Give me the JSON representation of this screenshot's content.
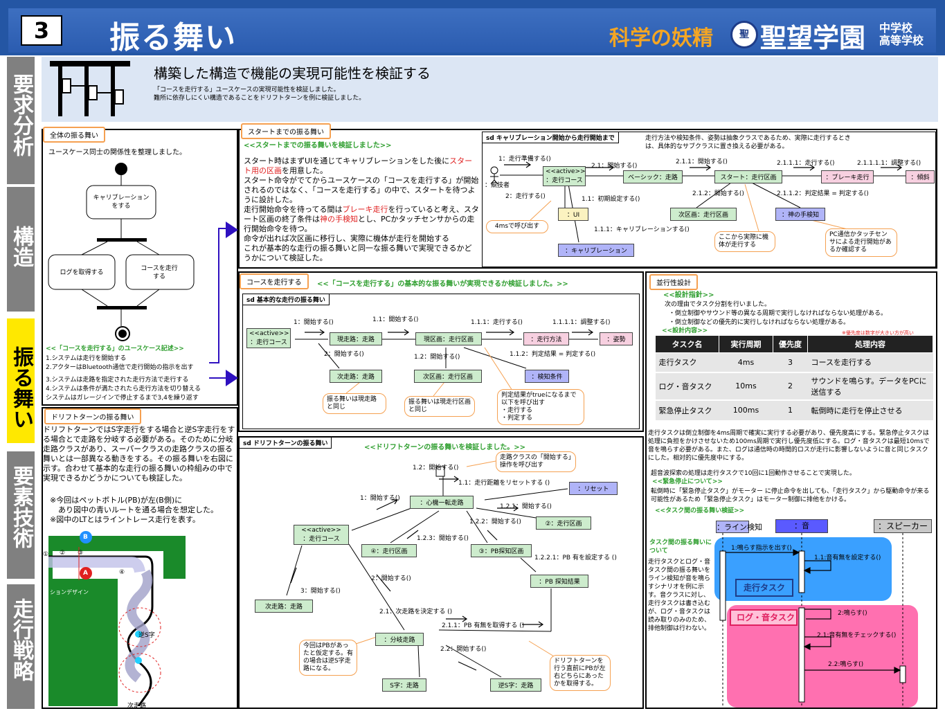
{
  "header": {
    "num": "3",
    "title": "振る舞い",
    "brand1": "科学の妖精",
    "logo": "聖",
    "brand2": "聖望学園",
    "brand3a": "中学校",
    "brand3b": "高等学校"
  },
  "sidebar": [
    "要求分析",
    "構造",
    "振る舞い",
    "要素技術",
    "走行戦略"
  ],
  "intro": {
    "title": "構築した構造で機能の実現可能性を検証する",
    "line1": "「コースを走行する」ユースケースの実現可能性を検証しました。",
    "line2": "難所に依存しにくい構造であることをドリフトターンを例に検証しました。"
  },
  "overall": {
    "tab": "全体の振る舞い",
    "desc": "ユースケース同士の関係性を整理しました。",
    "act1": "キャリブレーションをする",
    "act2": "ログを取得する",
    "act3": "コースを走行する",
    "ucTitle": "<<「コースを走行する」のユースケース記述>>",
    "uc": [
      "1.システムは走行を開始する",
      "2.アクターはBluetooth通信で走行開始の指示を出す",
      "3.システムは走路を指定された走行方法で走行する",
      "4.システムは条件が満たされたら走行方法を切り替える",
      "システムはガレージインで停止するまで3,4を繰り返す"
    ]
  },
  "start": {
    "tab": "スタートまでの振る舞い",
    "heading": "<<スタートまでの振る舞いを検証しました>>",
    "p1a": "スタート時はまずUIを通じてキャリブレーションをした後に",
    "p1r": "スタート用の区画",
    "p1b": "を用意した。",
    "p2": "スタート命令がでてからユースケースの「コースを走行する」が開始されるのではなく、「コースを走行する」の中で、スタートを待つように設計した。",
    "p3a": "走行開始命令を待ってる間は",
    "p3r": "ブレーキ走行",
    "p3b": "を行っていると考え、スタート区画の終了条件は",
    "p3r2": "神の手検知",
    "p3c": "とし、PCかタッチセンサからの走行開始命令を待つ。",
    "p4": "命令が出れば次区画に移行し、実際に機体が走行を開始する",
    "p5": "これが基本的な走行の振る舞いと同一な振る舞いで実現できるかどうかについて検証した。"
  },
  "calib": {
    "sd": "sd キャリブレーション開始から走行開始まで",
    "note": "走行方法や検知条件、姿勢は抽象クラスであるため、実際に走行するときは、具体的なサブクラスに置き換える必要がある。",
    "actor": "：競技者",
    "objs": {
      "run": "<<active>>\n：走行コース",
      "basic": "ベーシック：走路",
      "startz": "スタート：走行区画",
      "brake": "：ブレーキ走行",
      "incline": "：傾斜",
      "ui": "：UI",
      "next": "次区画：走行区画",
      "god": "：神の手検知",
      "calib": "：キャリブレーション"
    },
    "msgs": {
      "m1": "1：走行準備する()",
      "m2": "2：走行する()",
      "m21": "2.1：開始する()",
      "m211": "2.1.1：開始する()",
      "m2111": "2.1.1.1：走行する()",
      "m21111": "2.1.1.1.1：調整する()",
      "m212": "2.1.2：開始する()",
      "m2112": "2.1.1.2：判定結果 = 判定する()",
      "m11": "1.1：初期設定する()",
      "m111": "1.1.1：キャリブレーションする()"
    },
    "notes": {
      "n1": "4msで呼び出す",
      "n2": "ここから実際に機体が走行する",
      "n3": "PC通信かタッチセンサによる走行開始があるか確認する"
    }
  },
  "course": {
    "tab": "コースを走行する",
    "heading": "<<「コースを走行する」の基本的な振る舞いが実現できるか検証しました。>>",
    "sd": "sd 基本的な走行の振る舞い",
    "objs": {
      "run": "<<active>>\n：走行コース",
      "cur": "現走路：走路",
      "curz": "現区画：走行区画",
      "method": "：走行方法",
      "pose": "：姿勢",
      "nextr": "次走路：走路",
      "nextz": "次区画：走行区画",
      "cond": "：検知条件"
    },
    "msgs": {
      "m1": "1：開始する()",
      "m11": "1.1：開始する()",
      "m111": "1.1.1：走行する()",
      "m1111": "1.1.1.1：調整する()",
      "m2": "2：開始する()",
      "m12": "1.2：開始する()",
      "m112": "1.1.2：判定結果 = 判定する()"
    },
    "notes": {
      "n1": "振る舞いは現走路と同じ",
      "n2": "振る舞いは現走行区画と同じ",
      "n3": "判定結果がtrueになるまで以下を呼び出す\n・走行する\n・判定する"
    }
  },
  "drift": {
    "tab": "ドリフトターンの振る舞い",
    "text": "ドリフトターンではS字走行をする場合と逆S字走行をする場合とで走路を分岐する必要がある。そのために分岐走路クラスがあり、スーパークラスの走路クラスの振る舞いとは一部異なる動きをする。その振る舞いを右図に示す。合わせて基本的な走行の振る舞いの枠組みの中で実現できるかどうかについても検証した。",
    "note1": "※今回はペットボトル(PB)が左(B側)に",
    "note1b": "あり図中の青いルートを通る場合を想定した。",
    "note2": "※図中のLTとはライントレース走行を表す。",
    "mapLabels": {
      "b": "B",
      "a": "A",
      "c1": "①",
      "c2": "②",
      "c3": "③",
      "c4": "④",
      "s": "逆S字",
      "next": "次走路",
      "design": "ションデザイン"
    },
    "sd": "sd ドリフトターンの振る舞い",
    "heading": "<<ドリフトターンの振る舞いを検証しました。>>",
    "objs": {
      "run": "<<active>>\n：走行コース",
      "heart": "：心機一転走路",
      "reset": "：リセット",
      "z2": "②：走行区画",
      "z4": "④：走行区画",
      "pbz": "③：PB探知区画",
      "pbr": "：PB 探知結果",
      "nextr": "次走路：走路",
      "branch": "：分岐走路",
      "s": "S字：走路",
      "rs": "逆S字：走路"
    },
    "msgs": {
      "m12": "1.2：開始する()",
      "m11": "1.1：走行距離をリセットする ()",
      "m1": "1：開始する()",
      "m121": "1.2.1：開始する()",
      "m122": "1.2.2：開始する()",
      "m123": "1.2.3：開始する()",
      "m1221": "1.2.2.1：PB 有を設定する ()",
      "m2": "2：開始する()",
      "m3": "3：開始する()",
      "m21": "2.1：次走路を決定する ()",
      "m211": "2.1.1：PB 有無を取得する ()",
      "m22": "2.2：開始する()"
    },
    "notes": {
      "n0": "走路クラスの「開始する」操作を呼び出す",
      "n1": "今回はPBがあったと仮定する。有の場合は逆S字走路になる。",
      "n2": "ドリフトターンを行う直前にPBが左右どちらにあったかを取得する。"
    }
  },
  "concur": {
    "tab": "並行性設計",
    "h1": "<<設計指針>>",
    "p1": "次の理由でタスク分割を行いました。",
    "b1": "・倒立制御やサウンド等の異なる周期で実行しなければならない処理がある。",
    "b2": "・倒立制御などの優先的に実行しなければならない処理がある。",
    "h2": "<<設計内容>>",
    "redNote": "※優先度は数字が大きい方が高い",
    "cols": [
      "タスク名",
      "実行周期",
      "優先度",
      "処理内容"
    ],
    "rows": [
      [
        "走行タスク",
        "4ms",
        "3",
        "コースを走行する"
      ],
      [
        "ログ・音タスク",
        "10ms",
        "2",
        "サウンドを鳴らす。データをPCに送信する"
      ],
      [
        "緊急停止タスク",
        "100ms",
        "1",
        "転倒時に走行を停止させる"
      ]
    ],
    "p2": "走行タスクは倒立制御を4ms周期で確実に実行する必要があり、優先度高にする。緊急停止タスクは処理に負担をかけさせないため100ms周期で実行し優先度低にする。ログ・音タスクは最短10msで音を鳴らす必要がある。また、ログは通信時の時間的ロスが走行に影響しないように音と同じタスクにした。相対的に優先度中にする。",
    "p3": "超音波探索の処理は走行タスクで10回に1回動作させることで実現した。",
    "h3": "<<緊急停止について>>",
    "p4": "転倒時に「緊急停止タスク」がモーター に停止命令を出しても、「走行タスク」から駆動命令が来る可能性があるため「緊急停止タスク」はモーター制御に排他をかける。",
    "h4": "<<タスク間の振る舞い検証>>",
    "subh": "タスク間の振る舞いについて",
    "subp": "走行タスクとログ・音タスク間の振る舞いをライン検知が音を鳴らすシナリオを例に示す。音クラスに対し、走行タスクは書き込むが、ログ・音タスクは読み取りのみのため、排他制御は行わない。",
    "ll1": "：ライン検知",
    "ll2": "：音",
    "ll3": "：スピーカー",
    "task1": "走行タスク",
    "task2": "ログ・音タスク",
    "s1": "1:鳴らす指示を出す()",
    "s11": "1.1:音有無を設定する()",
    "s2": "2:鳴らす()",
    "s21": "2.1:音有無をチェックする()",
    "s22": "2.2:鳴らす()"
  }
}
